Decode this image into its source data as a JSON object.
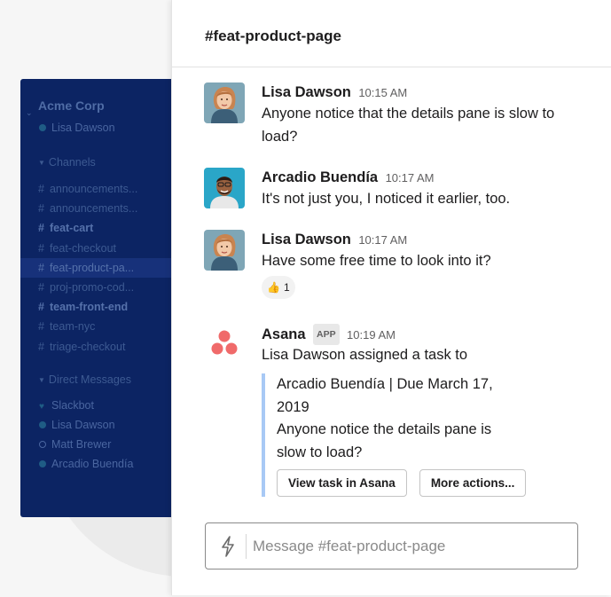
{
  "workspace": {
    "name": "Acme Corp",
    "current_user": "Lisa Dawson"
  },
  "sidebar": {
    "channels_header": "Channels",
    "channels": [
      {
        "name": "announcements...",
        "bold": false,
        "active": false
      },
      {
        "name": "announcements...",
        "bold": false,
        "active": false
      },
      {
        "name": "feat-cart",
        "bold": true,
        "active": false
      },
      {
        "name": "feat-checkout",
        "bold": false,
        "active": false
      },
      {
        "name": "feat-product-pa...",
        "bold": false,
        "active": true
      },
      {
        "name": "proj-promo-cod...",
        "bold": false,
        "active": false
      },
      {
        "name": "team-front-end",
        "bold": true,
        "active": false
      },
      {
        "name": "team-nyc",
        "bold": false,
        "active": false
      },
      {
        "name": "triage-checkout",
        "bold": false,
        "active": false
      }
    ],
    "dm_header": "Direct Messages",
    "dms": [
      {
        "name": "Slackbot",
        "status": "heart"
      },
      {
        "name": "Lisa Dawson",
        "status": "online"
      },
      {
        "name": "Matt Brewer",
        "status": "away"
      },
      {
        "name": "Arcadio Buendía",
        "status": "online"
      }
    ]
  },
  "channel": {
    "hash": "#",
    "name": "feat-product-page"
  },
  "messages": [
    {
      "author": "Lisa Dawson",
      "time": "10:15 AM",
      "text": "Anyone notice that the details pane is slow to load?",
      "avatar": "lisa-avatar"
    },
    {
      "author": "Arcadio Buendía",
      "time": "10:17 AM",
      "text": "It's not just you, I noticed it earlier, too.",
      "avatar": "arcadio-avatar"
    },
    {
      "author": "Lisa Dawson",
      "time": "10:17 AM",
      "text": "Have some free time to look into it?",
      "avatar": "lisa-avatar",
      "reaction": {
        "emoji": "👍",
        "count": "1"
      }
    },
    {
      "author": "Asana",
      "badge": "APP",
      "time": "10:19 AM",
      "text": "Lisa Dawson assigned a task to",
      "avatar": "asana-logo",
      "attachment": {
        "line1": "Arcadio Buendía | Due March 17, 2019",
        "line2": "Anyone notice the details pane is slow to load?",
        "buttons": [
          "View task in Asana",
          "More actions..."
        ]
      }
    }
  ],
  "composer": {
    "placeholder": "Message #feat-product-page",
    "icon": "lightning-bolt-icon"
  },
  "colors": {
    "sidebar_bg": "#0c2463",
    "attachment_bar": "#a8c9f5",
    "asana_coral": "#f06a6a"
  }
}
